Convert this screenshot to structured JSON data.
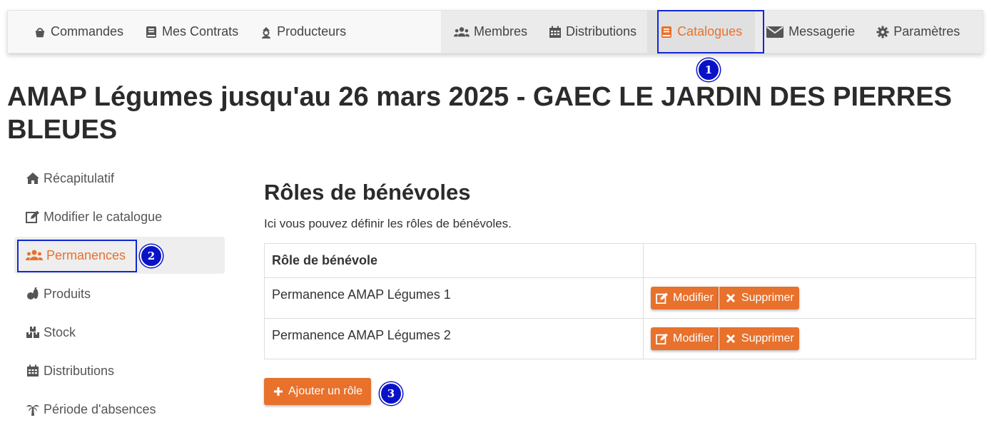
{
  "nav": {
    "left": [
      {
        "label": "Commandes",
        "icon": "basket-icon"
      },
      {
        "label": "Mes Contrats",
        "icon": "book-icon"
      },
      {
        "label": "Producteurs",
        "icon": "farmer-icon"
      }
    ],
    "right": [
      {
        "label": "Membres",
        "icon": "users-icon"
      },
      {
        "label": "Distributions",
        "icon": "calendar-icon"
      },
      {
        "label": "Catalogues",
        "icon": "book-icon",
        "active": true
      },
      {
        "label": "Messagerie",
        "icon": "envelope-icon"
      },
      {
        "label": "Paramètres",
        "icon": "gear-icon"
      }
    ]
  },
  "page_title": "AMAP Légumes jusqu'au 26 mars 2025 - GAEC LE JARDIN DES PIERRES BLEUES",
  "sidebar": {
    "items": [
      {
        "label": "Récapitulatif",
        "icon": "home-icon"
      },
      {
        "label": "Modifier le catalogue",
        "icon": "edit-icon"
      },
      {
        "label": "Permanences",
        "icon": "users-icon",
        "active": true
      },
      {
        "label": "Produits",
        "icon": "produce-icon"
      },
      {
        "label": "Stock",
        "icon": "boxes-icon"
      },
      {
        "label": "Distributions",
        "icon": "calendar-icon"
      },
      {
        "label": "Période d'absences",
        "icon": "palm-tree-icon"
      }
    ]
  },
  "main": {
    "title": "Rôles de bénévoles",
    "description": "Ici vous pouvez définir les rôles de bénévoles.",
    "table": {
      "headers": [
        "Rôle de bénévole",
        ""
      ],
      "rows": [
        {
          "role": "Permanence AMAP Légumes 1"
        },
        {
          "role": "Permanence AMAP Légumes 2"
        }
      ]
    },
    "edit_label": "Modifier",
    "delete_label": "Supprimer",
    "add_label": "Ajouter un rôle"
  },
  "callouts": [
    "1",
    "2",
    "3"
  ],
  "colors": {
    "accent": "#e8712c",
    "highlight": "#1327d6",
    "badge": "#0a12c8"
  }
}
